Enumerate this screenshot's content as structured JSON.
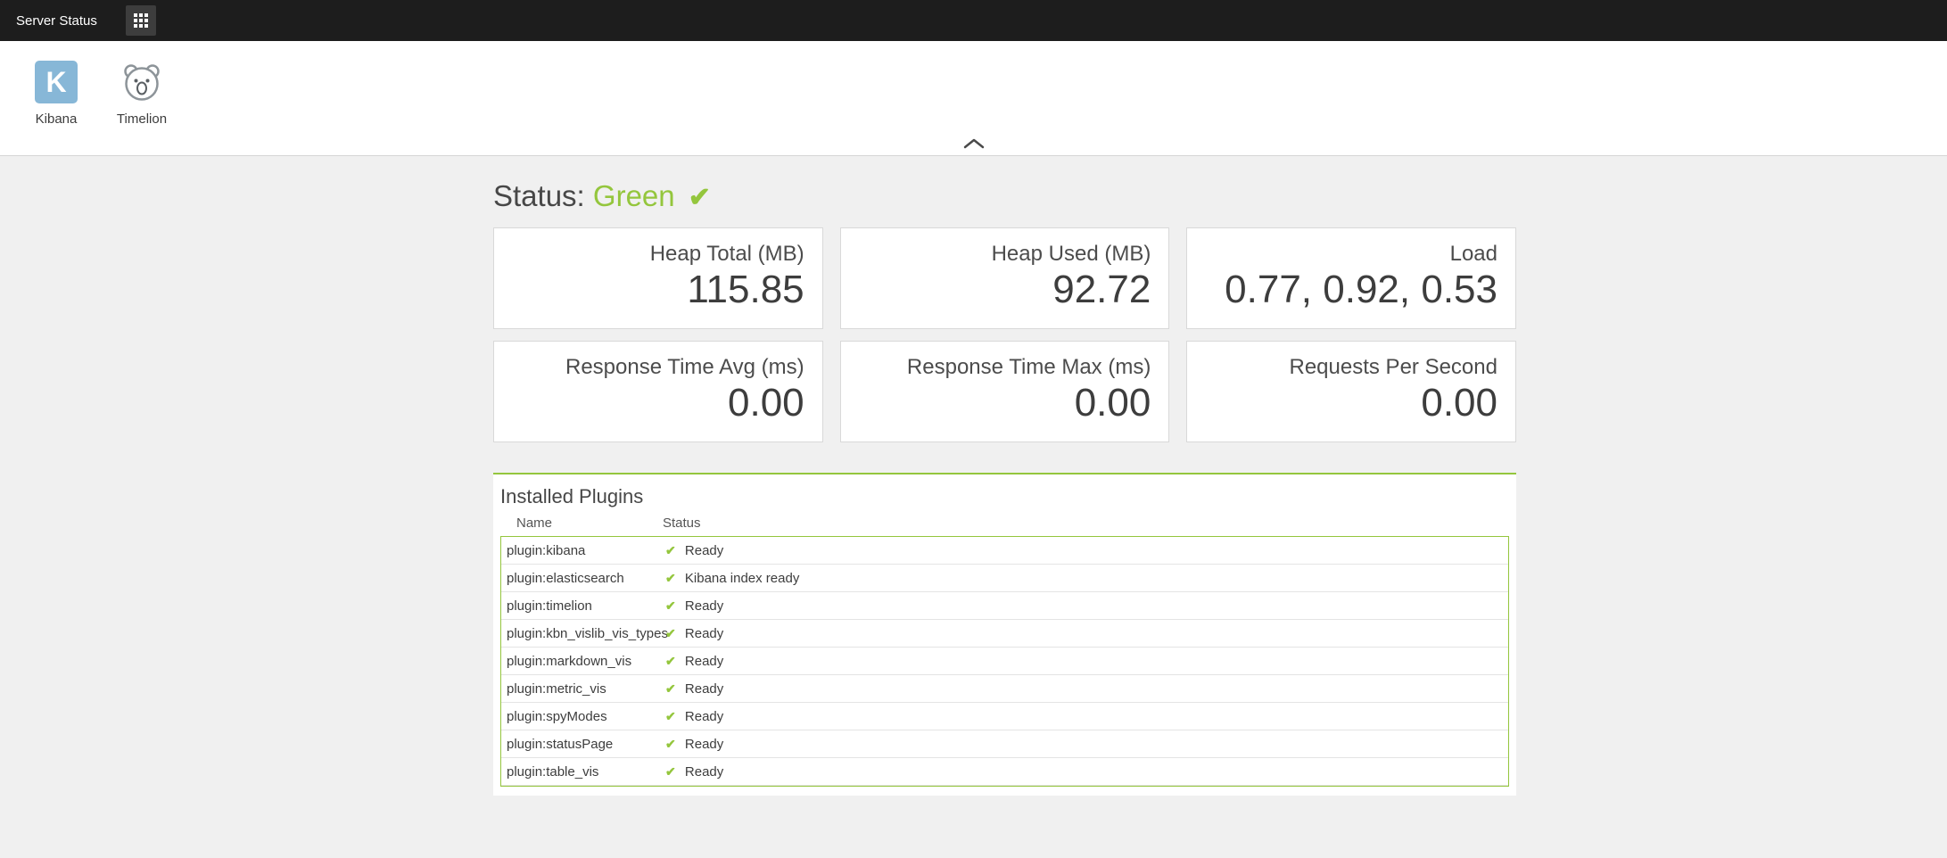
{
  "colors": {
    "green": "#94c63d",
    "kibana-blue": "#87b7d7",
    "topbar-bg": "#1d1d1d"
  },
  "icons": {
    "check": "✔"
  },
  "topbar": {
    "title": "Server Status"
  },
  "app_launcher": {
    "apps": [
      {
        "label": "Kibana",
        "initial": "K"
      },
      {
        "label": "Timelion"
      }
    ]
  },
  "status": {
    "label": "Status:",
    "value": "Green"
  },
  "metrics": [
    {
      "name": "Heap Total (MB)",
      "value": "115.85"
    },
    {
      "name": "Heap Used (MB)",
      "value": "92.72"
    },
    {
      "name": "Load",
      "value": "0.77, 0.92, 0.53"
    },
    {
      "name": "Response Time Avg (ms)",
      "value": "0.00"
    },
    {
      "name": "Response Time Max (ms)",
      "value": "0.00"
    },
    {
      "name": "Requests Per Second",
      "value": "0.00"
    }
  ],
  "plugins": {
    "title": "Installed Plugins",
    "columns": [
      "Name",
      "Status"
    ],
    "rows": [
      {
        "name": "plugin:kibana",
        "status": "Ready"
      },
      {
        "name": "plugin:elasticsearch",
        "status": "Kibana index ready"
      },
      {
        "name": "plugin:timelion",
        "status": "Ready"
      },
      {
        "name": "plugin:kbn_vislib_vis_types",
        "status": "Ready"
      },
      {
        "name": "plugin:markdown_vis",
        "status": "Ready"
      },
      {
        "name": "plugin:metric_vis",
        "status": "Ready"
      },
      {
        "name": "plugin:spyModes",
        "status": "Ready"
      },
      {
        "name": "plugin:statusPage",
        "status": "Ready"
      },
      {
        "name": "plugin:table_vis",
        "status": "Ready"
      }
    ]
  }
}
